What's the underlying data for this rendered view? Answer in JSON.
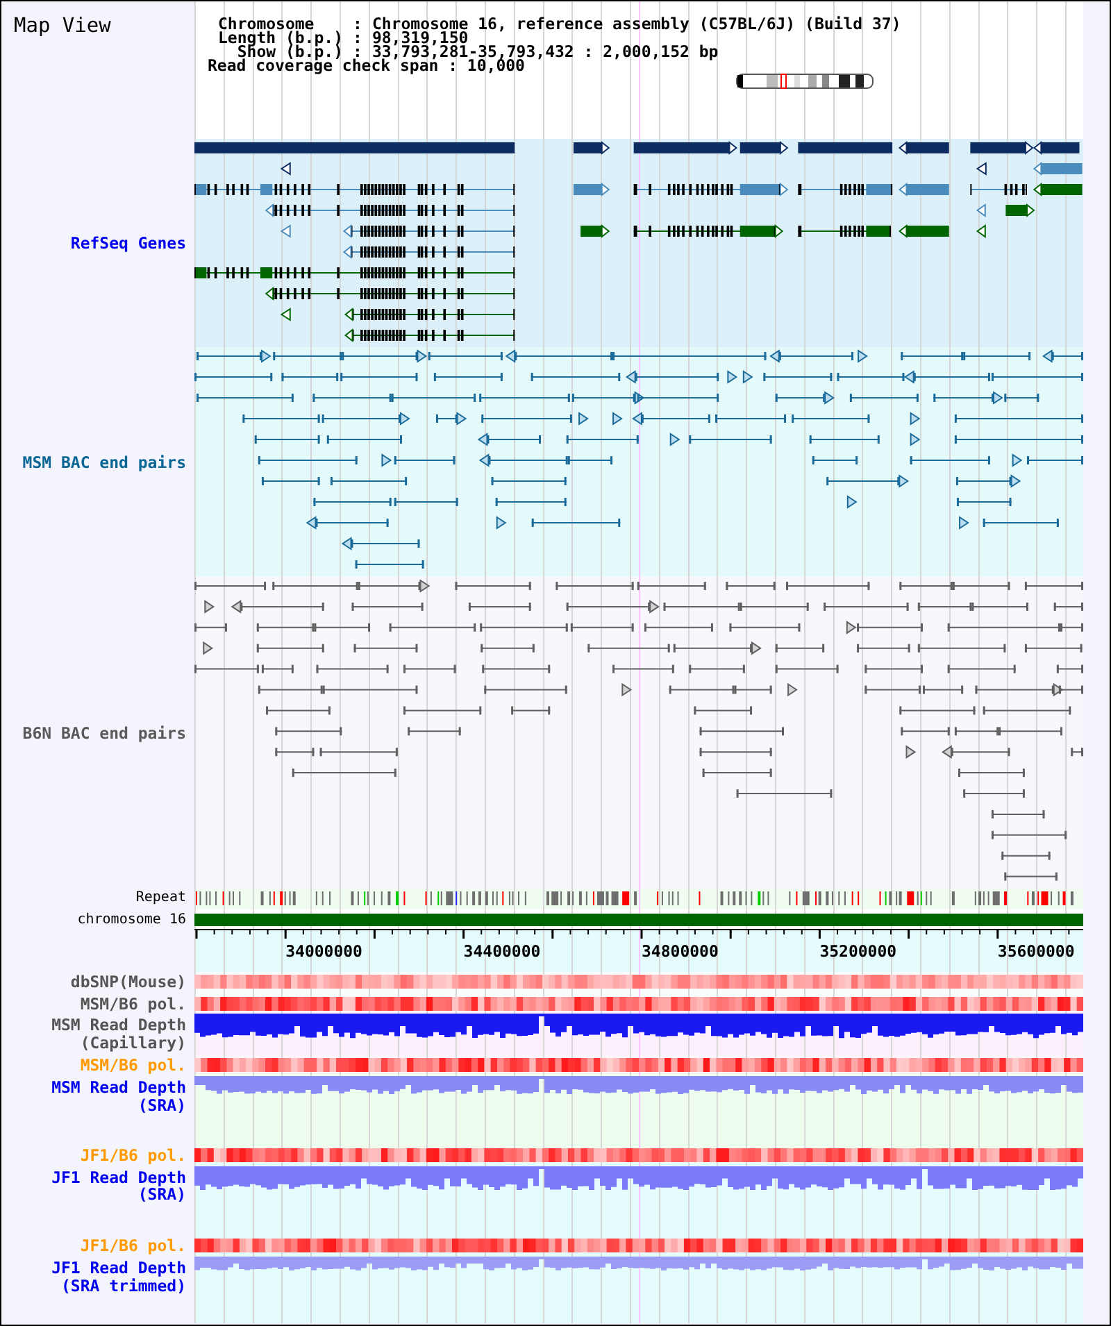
{
  "title": "Map View",
  "summary": [
    {
      "label": "Chromosome",
      "separator": ":",
      "value": "Chromosome 16, reference assembly (C57BL/6J) (Build 37)"
    },
    {
      "label": "Length (b.p.)",
      "separator": ":",
      "value": "98,319,150"
    },
    {
      "label": "Show (b.p.)",
      "separator": ":",
      "value": "33,793,281-35,793,432 : 2,000,152 bp"
    }
  ],
  "coverage_span": "Read coverage check span : 10,000",
  "tracks": [
    {
      "kind": "genes",
      "label": "RefSeq Genes",
      "color": "#0000ee"
    },
    {
      "kind": "bac",
      "label": "MSM BAC end pairs",
      "color": "#0a6694"
    },
    {
      "kind": "bac",
      "label": "B6N BAC end pairs",
      "color": "#5a5a5a"
    },
    {
      "kind": "repeat",
      "label": "Repeat",
      "color": "#000000"
    },
    {
      "kind": "chromosome",
      "label": "chromosome 16",
      "color": "#000000"
    },
    {
      "kind": "axis",
      "ticks": [
        "34000000",
        "34400000",
        "34800000",
        "35200000",
        "35600000"
      ]
    },
    {
      "kind": "heatmap",
      "label": "dbSNP(Mouse)",
      "color": "#555555"
    },
    {
      "kind": "heatmap",
      "label": "MSM/B6 pol.",
      "color": "#555555"
    },
    {
      "kind": "depth",
      "label": "MSM Read Depth (Capillary)",
      "color": "#555555"
    },
    {
      "kind": "heatmap",
      "label": "MSM/B6 pol.",
      "color": "#ff9900"
    },
    {
      "kind": "depth",
      "label": "MSM Read Depth (SRA)",
      "color": "#0000ee"
    },
    {
      "kind": "heatmap",
      "label": "JF1/B6 pol.",
      "color": "#ff9900"
    },
    {
      "kind": "depth",
      "label": "JF1 Read Depth (SRA)",
      "color": "#0000ee"
    },
    {
      "kind": "heatmap",
      "label": "JF1/B6 pol.",
      "color": "#ff9900"
    },
    {
      "kind": "depth",
      "label": "JF1 Read Depth (SRA trimmed)",
      "color": "#0000ee"
    }
  ]
}
